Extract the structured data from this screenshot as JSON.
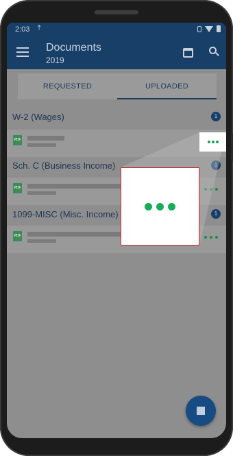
{
  "status_bar": {
    "time": "2:03",
    "upload_icon": "upload-icon",
    "right_icons": [
      "vibrate-icon",
      "wifi-icon",
      "battery-icon"
    ]
  },
  "app_bar": {
    "title": "Documents",
    "subtitle": "2019",
    "menu_icon": "menu-icon",
    "calendar_icon": "calendar-icon",
    "search_icon": "search-icon"
  },
  "tabs": [
    {
      "label": "REQUESTED",
      "active": false
    },
    {
      "label": "UPLOADED",
      "active": true
    }
  ],
  "sections": [
    {
      "label": "W-2 (Wages)",
      "count": "1",
      "doc_icon": "PDF"
    },
    {
      "label": "Sch. C (Business Income)",
      "count": "1",
      "doc_icon": "PDF"
    },
    {
      "label": "1099-MISC (Misc. Income)",
      "count": "1",
      "doc_icon": "PDF"
    }
  ],
  "fab": {
    "icon": "stop-icon"
  },
  "colors": {
    "header": "#183f68",
    "accent_green": "#17ad5a",
    "callout_border": "#c9282d"
  }
}
